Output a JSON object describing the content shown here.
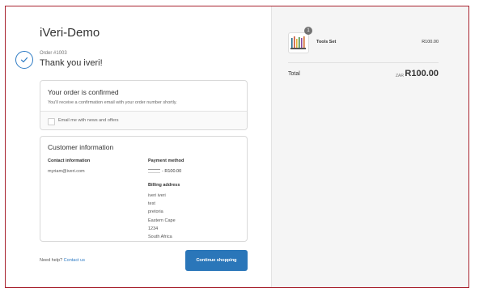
{
  "store": {
    "name": "iVeri-Demo"
  },
  "order": {
    "number": "Order #1003",
    "thank_you": "Thank you iveri!"
  },
  "confirmation": {
    "title": "Your order is confirmed",
    "text": "You'll receive a confirmation email with your order number shortly.",
    "newsletter_label": "Email me with news and offers"
  },
  "customer": {
    "title": "Customer information",
    "contact_label": "Contact information",
    "email": "myriam@iveri.com",
    "payment_label": "Payment method",
    "payment_amount": "- R100.00",
    "billing_label": "Billing address",
    "billing_lines": [
      "iveri iveri",
      "test",
      "pretoria",
      "Eastern Cape",
      "1234",
      "South Africa"
    ]
  },
  "footer": {
    "help_text": "Need help?",
    "contact_link": "Contact us",
    "continue_button": "Continue shopping"
  },
  "summary": {
    "product_name": "Tools Set",
    "product_price": "R100.00",
    "quantity": "1",
    "total_label": "Total",
    "currency": "ZAR",
    "total_amount": "R100.00"
  },
  "colors": {
    "accent": "#2a76b9",
    "border": "#a8232f",
    "panel_bg": "#f5f5f5"
  },
  "icons": {
    "confirmation": "check-circle-icon",
    "card": "card-icon"
  }
}
